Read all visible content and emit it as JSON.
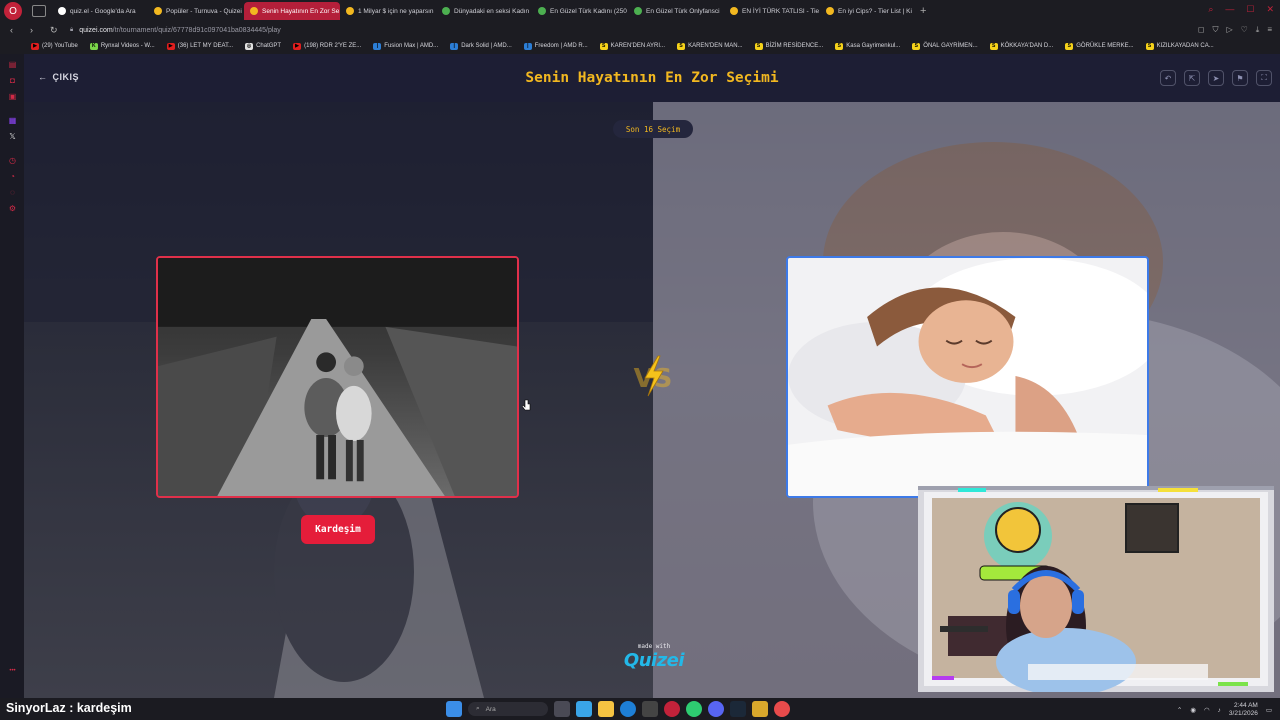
{
  "browser": {
    "tabs": [
      {
        "label": "quiz.el - Google'da Ara",
        "color": "#ffffff",
        "active": false
      },
      {
        "label": "Popüler - Turnuva - Quizei",
        "color": "#f2b820",
        "active": false
      },
      {
        "label": "Senin Hayatının En Zor Se",
        "color": "#f2b820",
        "active": true
      },
      {
        "label": "1 Milyar $ için ne yaparsın",
        "color": "#f2b820",
        "active": false
      },
      {
        "label": "Dünyadaki en seksi Kadın",
        "color": "#4caf50",
        "active": false
      },
      {
        "label": "En Güzel Türk Kadını (250",
        "color": "#4caf50",
        "active": false
      },
      {
        "label": "En Güzel Türk Onlyfansci",
        "color": "#4caf50",
        "active": false
      },
      {
        "label": "EN İYİ TÜRK TATLISI - Tie",
        "color": "#f2b820",
        "active": false
      },
      {
        "label": "En iyi Cips? - Tier List | Ki",
        "color": "#f2b820",
        "active": false
      }
    ],
    "url_host": "quizei.com",
    "url_path": "/tr/tournament/quiz/67778d91c097041ba0834445/play",
    "bookmarks": [
      {
        "label": "(29) YouTube",
        "color": "#e01e1e",
        "glyph": "▶"
      },
      {
        "label": "Rynxal Videos - W...",
        "color": "#7bd64a",
        "glyph": "K"
      },
      {
        "label": "(36) LET MY DEAT...",
        "color": "#e01e1e",
        "glyph": "▶"
      },
      {
        "label": "ChatGPT",
        "color": "#e0e0e0",
        "glyph": "◎"
      },
      {
        "label": "(198) RDR 2'YE ZE...",
        "color": "#e01e1e",
        "glyph": "▶"
      },
      {
        "label": "Fusion Max | AMD...",
        "color": "#2c7ed6",
        "glyph": "|"
      },
      {
        "label": "Dark Solid | AMD...",
        "color": "#2c7ed6",
        "glyph": "|"
      },
      {
        "label": "Freedom | AMD R...",
        "color": "#2c7ed6",
        "glyph": "|"
      },
      {
        "label": "KAREN'DEN AYRI...",
        "color": "#f5d21a",
        "glyph": "S"
      },
      {
        "label": "KAREN'DEN MAN...",
        "color": "#f5d21a",
        "glyph": "S"
      },
      {
        "label": "BİZİM RESİDENCE...",
        "color": "#f5d21a",
        "glyph": "S"
      },
      {
        "label": "Kasa Gayrimenkul...",
        "color": "#f5d21a",
        "glyph": "S"
      },
      {
        "label": "ÖNAL GAYRİMEN...",
        "color": "#f5d21a",
        "glyph": "S"
      },
      {
        "label": "KÖKKAYA'DAN D...",
        "color": "#f5d21a",
        "glyph": "S"
      },
      {
        "label": "GÖRÜKLE MERKE...",
        "color": "#f5d21a",
        "glyph": "S"
      },
      {
        "label": "KIZILKAYADAN CA...",
        "color": "#f5d21a",
        "glyph": "S"
      }
    ]
  },
  "quiz": {
    "exit_label": "ÇIKIŞ",
    "title": "Senin Hayatının En Zor Seçimi",
    "round_label": "Son 16 Seçim",
    "left_choice_label": "Kardeşim",
    "vs_text": "VS",
    "made_with": "made with",
    "brand": "Quizei",
    "colors": {
      "accent": "#f2b820",
      "left_border": "#e0304a",
      "right_border": "#3d7ae8",
      "label_bg": "#e51d3a"
    }
  },
  "taskbar": {
    "chat_user": "SinyorLaz",
    "chat_message": " : kardeşim",
    "search_placeholder": "Ara",
    "time": "2:44 AM",
    "date": "3/21/2026"
  }
}
